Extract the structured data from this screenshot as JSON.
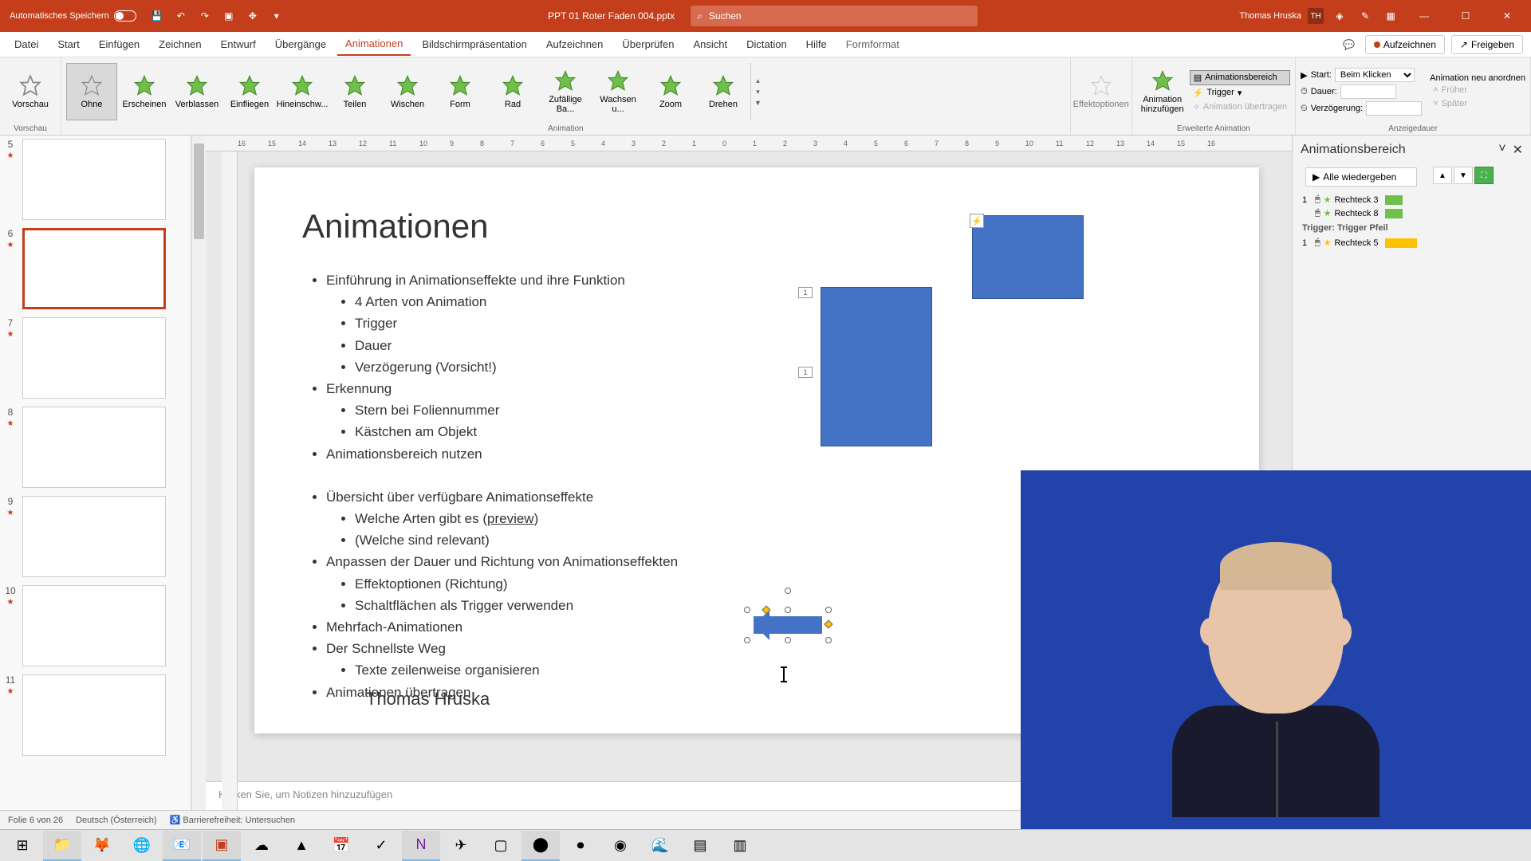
{
  "titlebar": {
    "autosave": "Automatisches Speichern",
    "filename": "PPT 01 Roter Faden 004.pptx",
    "search_placeholder": "Suchen",
    "user": "Thomas Hruska",
    "initials": "TH"
  },
  "menu": {
    "items": [
      "Datei",
      "Start",
      "Einfügen",
      "Zeichnen",
      "Entwurf",
      "Übergänge",
      "Animationen",
      "Bildschirmpräsentation",
      "Aufzeichnen",
      "Überprüfen",
      "Ansicht",
      "Dictation",
      "Hilfe",
      "Formformat"
    ],
    "active_index": 6,
    "record": "Aufzeichnen",
    "share": "Freigeben"
  },
  "ribbon": {
    "preview": "Vorschau",
    "preview_group": "Vorschau",
    "anims": [
      "Ohne",
      "Erscheinen",
      "Verblassen",
      "Einfliegen",
      "Hineinschw...",
      "Teilen",
      "Wischen",
      "Form",
      "Rad",
      "Zufällige Ba...",
      "Wachsen u...",
      "Zoom",
      "Drehen"
    ],
    "animation_group": "Animation",
    "effect_options": "Effektoptionen",
    "add_anim": "Animation hinzufügen",
    "pane_btn": "Animationsbereich",
    "trigger": "Trigger",
    "painter": "Animation übertragen",
    "erweitert_group": "Erweiterte Animation",
    "start": "Start:",
    "start_val": "Beim Klicken",
    "duration": "Dauer:",
    "delay": "Verzögerung:",
    "reorder": "Animation neu anordnen",
    "earlier": "Früher",
    "later": "Später",
    "timing_group": "Anzeigedauer"
  },
  "thumbs": [
    {
      "num": "5",
      "star": true
    },
    {
      "num": "6",
      "star": true,
      "active": true
    },
    {
      "num": "7",
      "star": true
    },
    {
      "num": "8",
      "star": true
    },
    {
      "num": "9",
      "star": true
    },
    {
      "num": "10",
      "star": true
    },
    {
      "num": "11",
      "star": true
    }
  ],
  "slide": {
    "title": "Animationen",
    "b1": "Einführung in Animationseffekte und ihre Funktion",
    "b1a": "4 Arten von Animation",
    "b1b": "Trigger",
    "b1c": "Dauer",
    "b1d": "Verzögerung (Vorsicht!)",
    "b2": "Erkennung",
    "b2a": "Stern bei Foliennummer",
    "b2b": "Kästchen am Objekt",
    "b3": "Animationsbereich nutzen",
    "b4": "Übersicht über verfügbare Animationseffekte",
    "b4a_pre": "Welche Arten gibt es (",
    "b4a_link": "preview",
    "b4a_post": ")",
    "b4b": "(Welche sind relevant)",
    "b5": "Anpassen der Dauer und Richtung von Animationseffekten",
    "b5a": "Effektoptionen (Richtung)",
    "b5b": "Schaltflächen als Trigger verwenden",
    "b6": "Mehrfach-Animationen",
    "b7": "Der Schnellste Weg",
    "b7a": "Texte zeilenweise organisieren",
    "b8": "Animationen übertragen",
    "author": "Thomas Hruska",
    "tag1": "1",
    "tag2": "1"
  },
  "notes": "Klicken Sie, um Notizen hinzuzufügen",
  "anim_pane": {
    "title": "Animationsbereich",
    "play": "Alle wiedergeben",
    "items": [
      {
        "num": "1",
        "name": "Rechteck 3",
        "color": "#6fbf4b"
      },
      {
        "num": "",
        "name": "Rechteck 8",
        "color": "#6fbf4b"
      }
    ],
    "trigger_label": "Trigger: Trigger Pfeil",
    "trigger_items": [
      {
        "num": "1",
        "name": "Rechteck 5",
        "color": "#ffc000"
      }
    ]
  },
  "status": {
    "slide": "Folie 6 von 26",
    "lang": "Deutsch (Österreich)",
    "access": "Barrierefreiheit: Untersuchen"
  },
  "ruler_h": [
    "16",
    "15",
    "14",
    "13",
    "12",
    "11",
    "10",
    "9",
    "8",
    "7",
    "6",
    "5",
    "4",
    "3",
    "2",
    "1",
    "0",
    "1",
    "2",
    "3",
    "4",
    "5",
    "6",
    "7",
    "8",
    "9",
    "10",
    "11",
    "12",
    "13",
    "14",
    "15",
    "16"
  ]
}
